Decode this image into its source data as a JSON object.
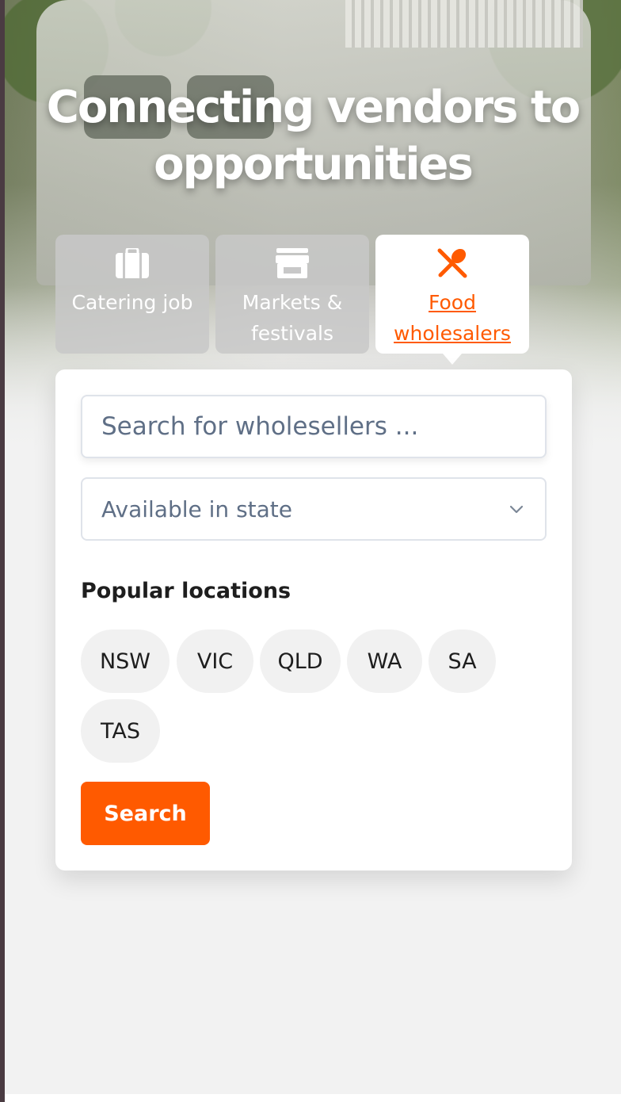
{
  "hero": {
    "headline": "Connecting vendors to opportunities"
  },
  "tabs": [
    {
      "label": "Catering job",
      "icon": "briefcase-icon",
      "active": false
    },
    {
      "label": "Markets & festivals",
      "icon": "storefront-icon",
      "active": false
    },
    {
      "label": "Food wholesalers",
      "icon": "cutlery-icon",
      "active": true
    }
  ],
  "search": {
    "placeholder": "Search for wholesellers ...",
    "value": ""
  },
  "state_select": {
    "value": "Available in state"
  },
  "popular": {
    "title": "Popular locations",
    "chips": [
      "NSW",
      "VIC",
      "QLD",
      "WA",
      "SA",
      "TAS"
    ]
  },
  "actions": {
    "search_label": "Search"
  },
  "colors": {
    "accent": "#ff5a00",
    "page_bg": "#f2f2f2",
    "placeholder": "#5f6f86"
  }
}
